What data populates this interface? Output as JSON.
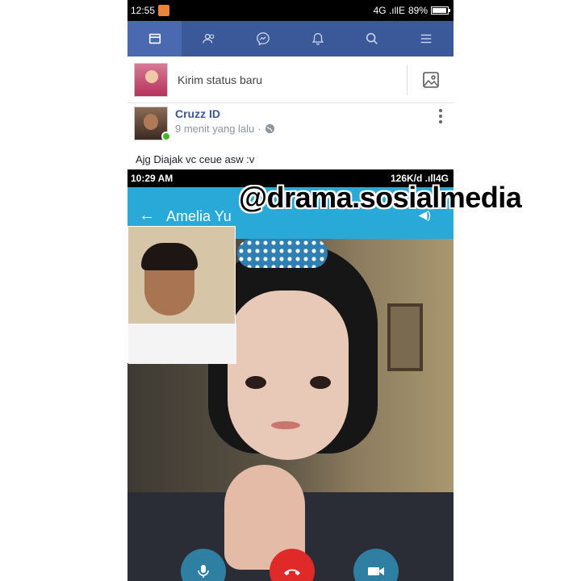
{
  "status_bar": {
    "time": "12:55",
    "network": "4G .ıllE",
    "battery": "89%"
  },
  "navbar": {
    "tabs": [
      "news-feed",
      "friends",
      "messenger",
      "notifications",
      "search",
      "menu"
    ]
  },
  "composer": {
    "placeholder": "Kirim status baru"
  },
  "post": {
    "author": "Cruzz ID",
    "time": "9 menit yang lalu",
    "separator": "·",
    "text": "Ajg Diajak vc ceue asw :v"
  },
  "embedded": {
    "time": "10:29 AM",
    "status_right": "126K/d .ıll4G",
    "caller_name": "Amelia Yu",
    "back_glyph": "←",
    "speaker_glyph": "◀)"
  },
  "watermark": "@drama.sosialmedia",
  "colors": {
    "fb_blue": "#3b5998",
    "call_blue": "#29a9d8",
    "end_red": "#e02a2a"
  }
}
